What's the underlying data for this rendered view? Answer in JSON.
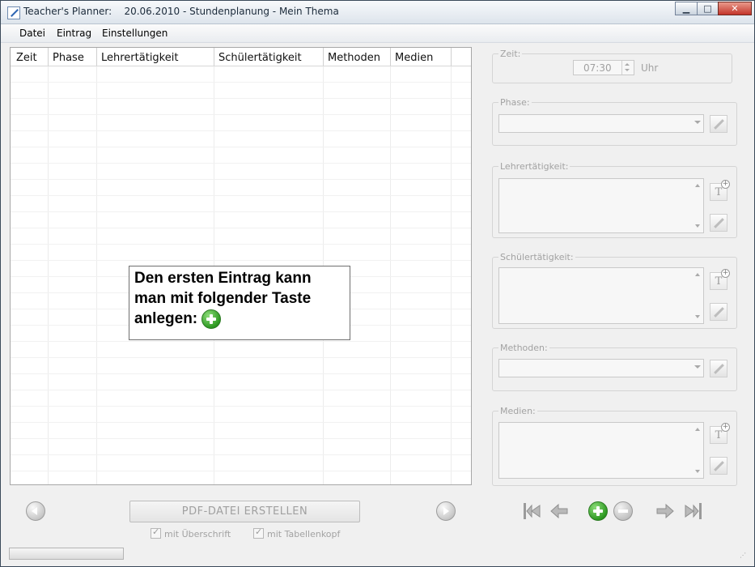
{
  "window": {
    "title": "Teacher's Planner:    20.06.2010 - Stundenplanung - Mein Thema",
    "minimize": "▁",
    "maximize": "□",
    "close": "✕"
  },
  "menu": [
    "Datei",
    "Eintrag",
    "Einstellungen"
  ],
  "table": {
    "columns": [
      "Zeit",
      "Phase",
      "Lehrertätigkeit",
      "Schülertätigkeit",
      "Methoden",
      "Medien"
    ],
    "rows": []
  },
  "tooltip": {
    "line1": "Den ersten Eintrag kann",
    "line2": "man mit folgender Taste",
    "line3": "anlegen:"
  },
  "form": {
    "zeit": {
      "label": "Zeit:",
      "value": "07:30",
      "unit": "Uhr"
    },
    "phase": {
      "label": "Phase:",
      "value": ""
    },
    "lehrertaetigkeit": {
      "label": "Lehrertätigkeit:",
      "value": ""
    },
    "schuelertaetigkeit": {
      "label": "Schülertätigkeit:",
      "value": ""
    },
    "methoden": {
      "label": "Methoden:",
      "value": ""
    },
    "medien": {
      "label": "Medien:",
      "value": ""
    }
  },
  "footer": {
    "pdf_button": "PDF-DATEI ERSTELLEN",
    "checkbox_title": "mit Überschrift",
    "checkbox_header": "mit Tabellenkopf",
    "checkbox_title_checked": true,
    "checkbox_header_checked": true
  },
  "colors": {
    "accent_green": "#2e9a22",
    "disabled_text": "#a2a2a2"
  }
}
